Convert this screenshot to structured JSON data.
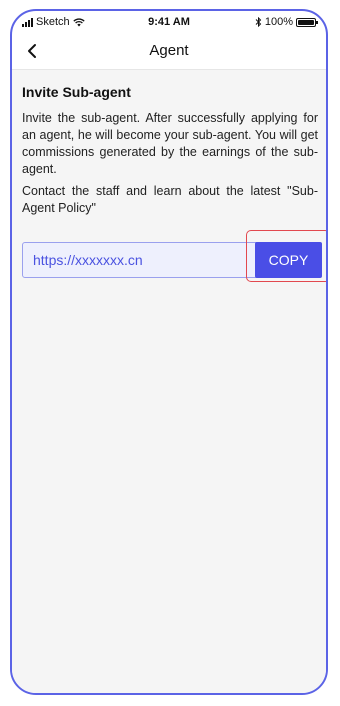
{
  "status_bar": {
    "carrier": "Sketch",
    "time": "9:41 AM",
    "battery_percent": "100%",
    "icons": [
      "signal-icon",
      "wifi-icon",
      "bluetooth-icon",
      "battery-icon"
    ]
  },
  "nav": {
    "title": "Agent",
    "back_icon": "chevron-left-icon"
  },
  "invite": {
    "title": "Invite Sub-agent",
    "description": "Invite the sub-agent. After successfully applying for an agent, he will become your sub-agent. You will get commissions generated by the earnings of the sub-agent.",
    "contact_note": "Contact the staff and learn about the latest \"Sub-Agent Policy\"",
    "link": "https://xxxxxxx.cn",
    "copy_label": "COPY"
  },
  "colors": {
    "accent": "#4a4ee6",
    "device_border": "#5b63e6",
    "highlight": "#e2484f",
    "link_bg": "#eef0fd",
    "content_bg": "#f5f5f5"
  }
}
